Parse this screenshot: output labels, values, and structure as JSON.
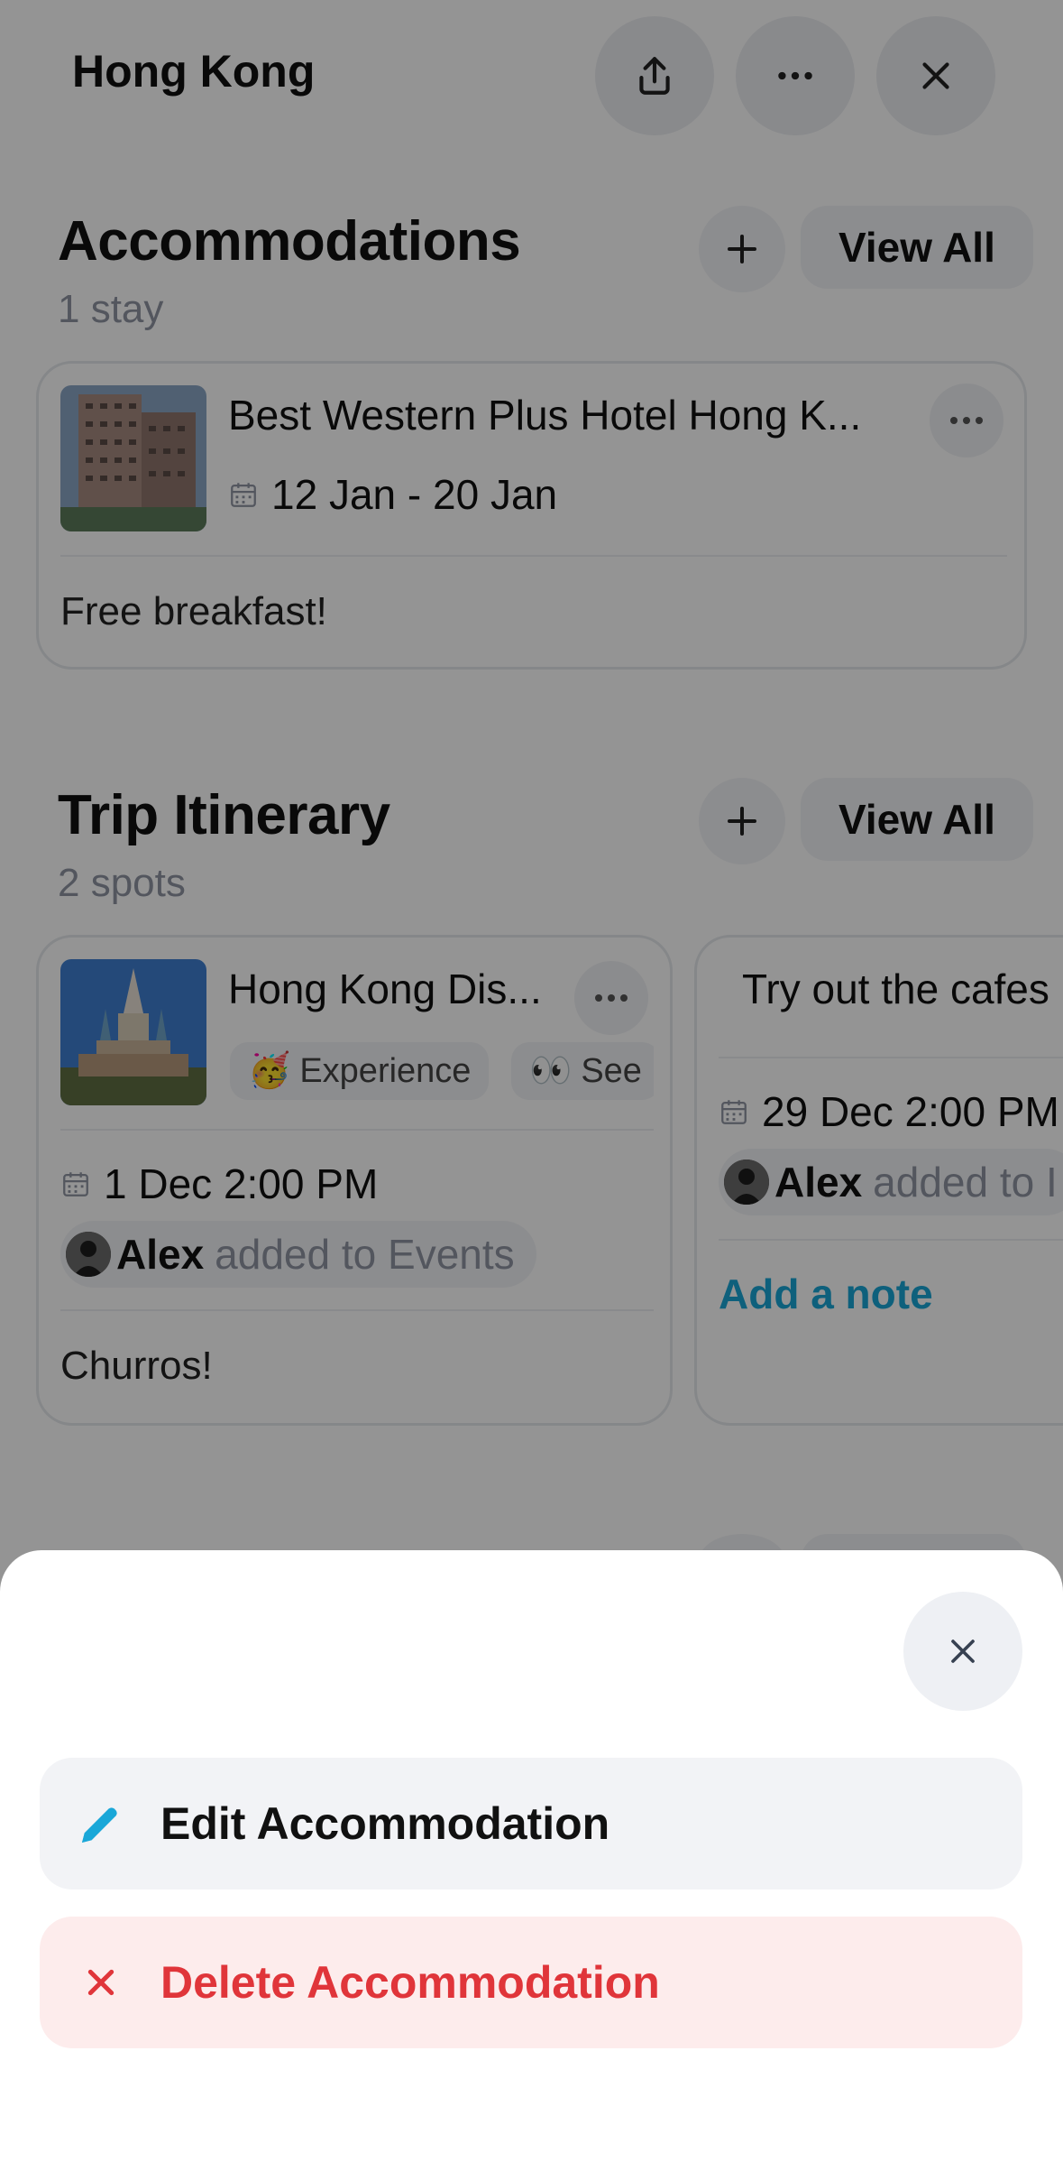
{
  "header": {
    "title": "Hong Kong",
    "share_icon": "share-icon",
    "more_icon": "more-horizontal-icon",
    "close_icon": "close-icon"
  },
  "accommodations": {
    "title": "Accommodations",
    "subtitle": "1 stay",
    "view_all_label": "View All",
    "items": [
      {
        "name": "Best Western Plus Hotel Hong K...",
        "dates": "12 Jan - 20 Jan",
        "note": "Free breakfast!"
      }
    ]
  },
  "itinerary": {
    "title": "Trip Itinerary",
    "subtitle": "2 spots",
    "view_all_label": "View All",
    "items": [
      {
        "name": "Hong Kong Dis...",
        "tags": [
          {
            "emoji": "🥳",
            "label": "Experience"
          },
          {
            "emoji": "👀",
            "label": "See"
          }
        ],
        "datetime": "1 Dec 2:00 PM",
        "added_by": "Alex",
        "added_text": "added to Events",
        "note": "Churros!"
      },
      {
        "name": "Try out the cafes",
        "datetime": "29 Dec 2:00 PM",
        "added_by": "Alex",
        "added_text": "added to I",
        "add_note_label": "Add a note"
      }
    ]
  },
  "sheet": {
    "close_icon": "close-icon",
    "actions": [
      {
        "label": "Edit Accommodation",
        "icon": "pencil-icon",
        "color": "#1aa7d8"
      },
      {
        "label": "Delete Accommodation",
        "icon": "x-icon",
        "color": "#e0353a"
      }
    ]
  },
  "colors": {
    "accent": "#19a5d6",
    "danger": "#e0353a",
    "muted_text": "#8f95a3"
  }
}
